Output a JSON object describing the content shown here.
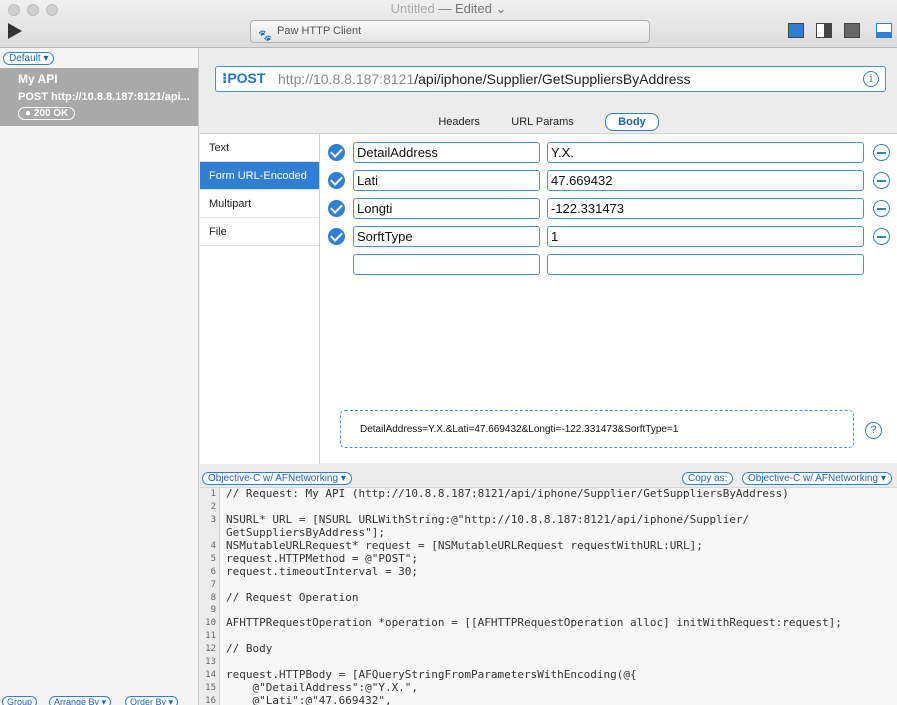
{
  "window": {
    "title_untitled": "Untitled",
    "title_edited": "— Edited",
    "title_chevron": "⌄",
    "app_badge": "Paw HTTP Client"
  },
  "sidebar": {
    "filter_label": "Default ▾",
    "request": {
      "name": "My API",
      "method": "POST",
      "url": "http://10.8.8.187:8121/api...",
      "status": "● 200 OK"
    },
    "bottom": {
      "group": "Group",
      "arrange": "Arrange By ▾",
      "order": "Order By ▾"
    }
  },
  "urlbar": {
    "method": "⁝POST",
    "host": "http://10.8.8.187:8121",
    "path": "/api/iphone/Supplier/GetSuppliersByAddress",
    "info": "i"
  },
  "tabs": [
    {
      "label": "Headers"
    },
    {
      "label": "URL Params"
    },
    {
      "label": "Body"
    }
  ],
  "body_types": [
    {
      "label": "Text"
    },
    {
      "label": "Form URL-Encoded"
    },
    {
      "label": "Multipart"
    },
    {
      "label": "File"
    }
  ],
  "params": [
    {
      "key": "DetailAddress",
      "value": "Y.X."
    },
    {
      "key": "Lati",
      "value": "47.669432"
    },
    {
      "key": "Longti",
      "value": "-122.331473"
    },
    {
      "key": "SorftType",
      "value": "1"
    }
  ],
  "preview": "DetailAddress=Y.X.&Lati=47.669432&Longti=-122.331473&SorftType=1",
  "help": "?",
  "codegen": {
    "lang_left": "Objective-C w/ AFNetworking ▾",
    "copy_as": "Copy as:",
    "lang_right": "Objective-C w/ AFNetworking ▾",
    "lines": [
      {
        "n": "1",
        "t": "// Request: My API (http://10.8.8.187:8121/api/iphone/Supplier/GetSuppliersByAddress)"
      },
      {
        "n": "2",
        "t": ""
      },
      {
        "n": "3",
        "t": "NSURL* URL = [NSURL URLWithString:@\"http://10.8.8.187:8121/api/iphone/Supplier/"
      },
      {
        "n": "",
        "t": "GetSuppliersByAddress\"];"
      },
      {
        "n": "4",
        "t": "NSMutableURLRequest* request = [NSMutableURLRequest requestWithURL:URL];"
      },
      {
        "n": "5",
        "t": "request.HTTPMethod = @\"POST\";"
      },
      {
        "n": "6",
        "t": "request.timeoutInterval = 30;"
      },
      {
        "n": "7",
        "t": ""
      },
      {
        "n": "8",
        "t": "// Request Operation"
      },
      {
        "n": "9",
        "t": ""
      },
      {
        "n": "10",
        "t": "AFHTTPRequestOperation *operation = [[AFHTTPRequestOperation alloc] initWithRequest:request];"
      },
      {
        "n": "11",
        "t": ""
      },
      {
        "n": "12",
        "t": "// Body"
      },
      {
        "n": "13",
        "t": ""
      },
      {
        "n": "14",
        "t": "request.HTTPBody = [AFQueryStringFromParametersWithEncoding(@{"
      },
      {
        "n": "15",
        "t": "    @\"DetailAddress\":@\"Y.X.\","
      },
      {
        "n": "16",
        "t": "    @\"Lati\":@\"47.669432\","
      }
    ]
  }
}
